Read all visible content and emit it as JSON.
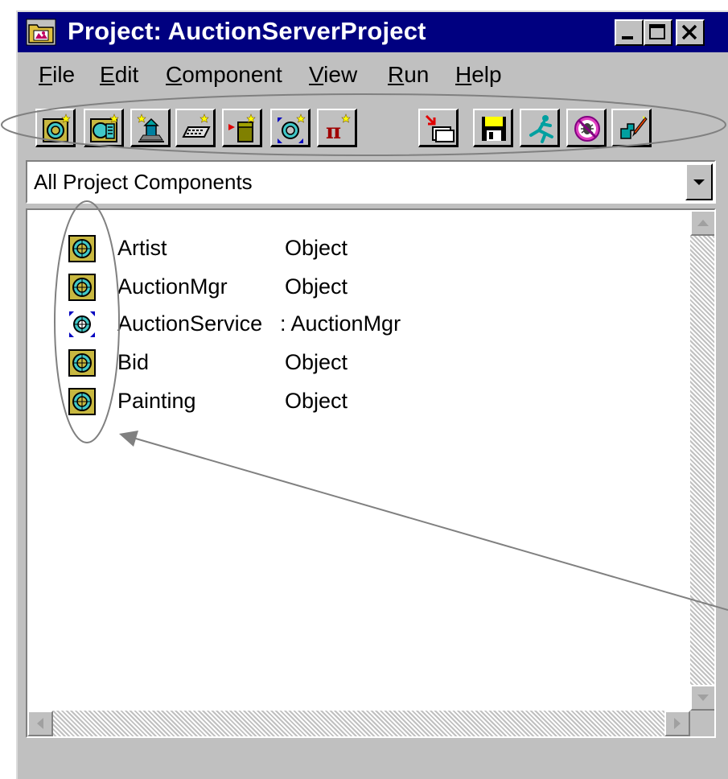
{
  "window": {
    "title": "Project: AuctionServerProject",
    "controls": [
      "minimize-icon",
      "maximize-icon",
      "close-icon"
    ]
  },
  "menu": [
    {
      "label": "File",
      "mnemonic": "F",
      "rest": "ile"
    },
    {
      "label": "Edit",
      "mnemonic": "E",
      "rest": "dit"
    },
    {
      "label": "Component",
      "mnemonic": "C",
      "rest": "omponent"
    },
    {
      "label": "View",
      "mnemonic": "V",
      "rest": "iew"
    },
    {
      "label": "Run",
      "mnemonic": "R",
      "rest": "un"
    },
    {
      "label": "Help",
      "mnemonic": "H",
      "rest": "elp"
    }
  ],
  "toolbar": {
    "group1": [
      "new-object-icon",
      "new-tool-object-icon",
      "new-component-icon",
      "new-keyboard-icon",
      "import-icon",
      "new-service-icon",
      "new-constant-icon"
    ],
    "group2": [
      "copy-icon",
      "save-icon",
      "run-icon",
      "debug-icon",
      "edit-icon"
    ]
  },
  "filter": {
    "selected": "All Project Components"
  },
  "components": [
    {
      "name": "Artist",
      "type": "Object",
      "icon": "object-icon"
    },
    {
      "name": "AuctionMgr",
      "type": "Object",
      "icon": "object-icon"
    },
    {
      "name": "AuctionService",
      "type": ": AuctionMgr",
      "icon": "service-icon"
    },
    {
      "name": "Bid",
      "type": "Object",
      "icon": "object-icon"
    },
    {
      "name": "Painting",
      "type": "Object",
      "icon": "object-icon"
    }
  ],
  "colors": {
    "titlebar": "#000080",
    "face": "#c0c0c0",
    "annotation": "#808080"
  }
}
